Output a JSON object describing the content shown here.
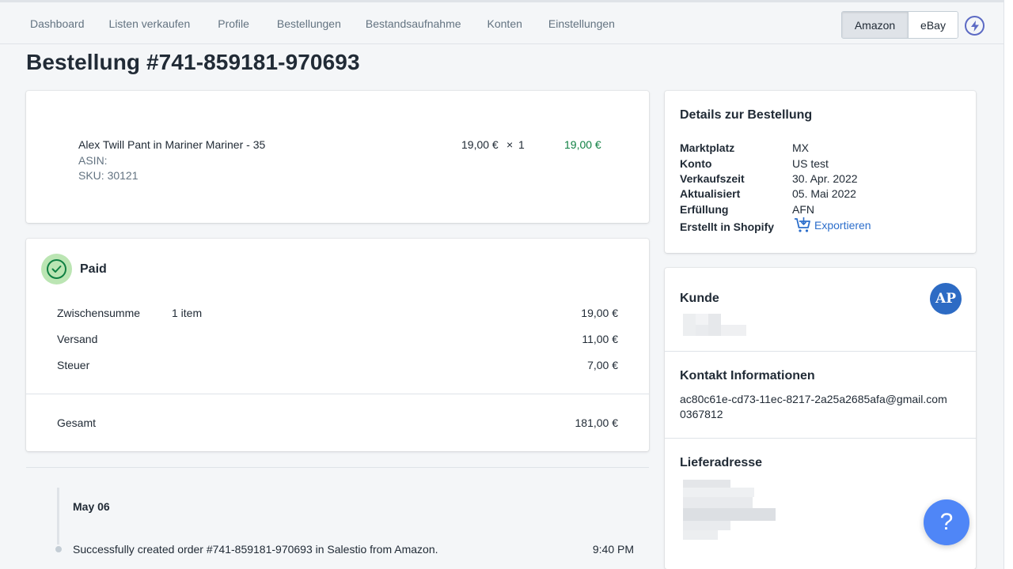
{
  "nav": {
    "items": [
      "Dashboard",
      "Listen verkaufen",
      "Profile",
      "Bestellungen",
      "Bestandsaufnahme",
      "Konten",
      "Einstellungen"
    ]
  },
  "marketplace_toggle": {
    "active": "Amazon",
    "inactive": "eBay"
  },
  "page_title": "Bestellung #741-859181-970693",
  "line_item": {
    "title": "Alex Twill Pant in Mariner Mariner - 35",
    "asin_label": "ASIN:",
    "sku_label": "SKU: 30121",
    "unit_price": "19,00 €",
    "times": "×",
    "quantity": "1",
    "total": "19,00 €"
  },
  "payment": {
    "status": "Paid",
    "rows": [
      {
        "label": "Zwischensumme",
        "detail": "1 item",
        "amount": "19,00 €"
      },
      {
        "label": "Versand",
        "detail": "",
        "amount": "11,00 €"
      },
      {
        "label": "Steuer",
        "detail": "",
        "amount": "7,00 €"
      }
    ],
    "total_label": "Gesamt",
    "total_amount": "181,00 €"
  },
  "timeline": {
    "date": "May 06",
    "event_text": "Successfully created order #741-859181-970693 in Salestio from Amazon.",
    "event_time": "9:40 PM"
  },
  "order_details": {
    "heading": "Details zur Bestellung",
    "rows": [
      {
        "label": "Marktplatz",
        "value": "MX"
      },
      {
        "label": "Konto",
        "value": "US test"
      },
      {
        "label": "Verkaufszeit",
        "value": "30. Apr. 2022"
      },
      {
        "label": "Aktualisiert",
        "value": "05. Mai 2022"
      },
      {
        "label": "Erfüllung",
        "value": "AFN"
      }
    ],
    "shopify_label": "Erstellt in Shopify",
    "export_label": "Exportieren"
  },
  "customer": {
    "heading": "Kunde",
    "avatar_initials": "AP",
    "contact_heading": "Kontakt Informationen",
    "email": "ac80c61e-cd73-11ec-8217-2a25a2685afa@gmail.com",
    "phone": "0367812",
    "shipping_heading": "Lieferadresse"
  },
  "help_button": "?",
  "colors": {
    "accent": "#5c6ac4",
    "success": "#108043",
    "link": "#2c6ecb",
    "help": "#4f86f7"
  }
}
